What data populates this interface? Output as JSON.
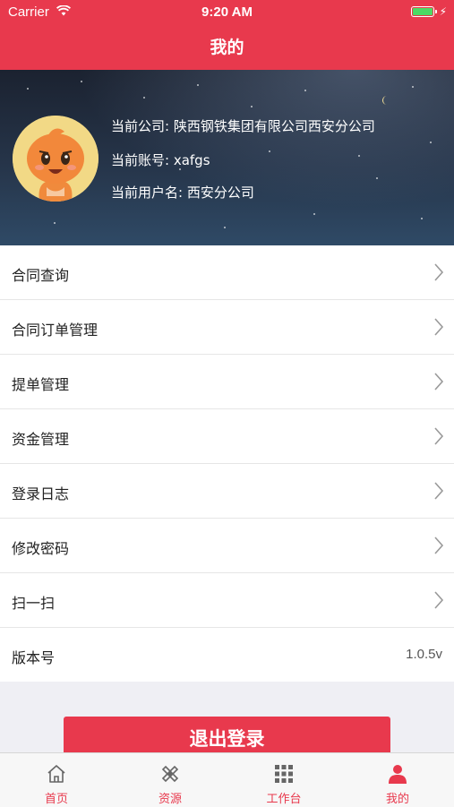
{
  "status_bar": {
    "carrier": "Carrier",
    "time": "9:20 AM"
  },
  "header": {
    "title": "我的"
  },
  "profile": {
    "company": "当前公司: 陕西钢铁集团有限公司西安分公司",
    "account": "当前账号: xafgs",
    "username": "当前用户名: 西安分公司"
  },
  "menu": [
    {
      "label": "合同查询"
    },
    {
      "label": "合同订单管理"
    },
    {
      "label": "提单管理"
    },
    {
      "label": "资金管理"
    },
    {
      "label": "登录日志"
    },
    {
      "label": "修改密码"
    },
    {
      "label": "扫一扫"
    }
  ],
  "version": {
    "label": "版本号",
    "value": "1.0.5v"
  },
  "logout_label": "退出登录",
  "tabs": [
    {
      "label": "首页",
      "icon": "home-icon"
    },
    {
      "label": "资源",
      "icon": "resource-icon"
    },
    {
      "label": "工作台",
      "icon": "grid-icon"
    },
    {
      "label": "我的",
      "icon": "user-icon"
    }
  ],
  "colors": {
    "accent": "#e8394d",
    "battery": "#4cd964"
  }
}
